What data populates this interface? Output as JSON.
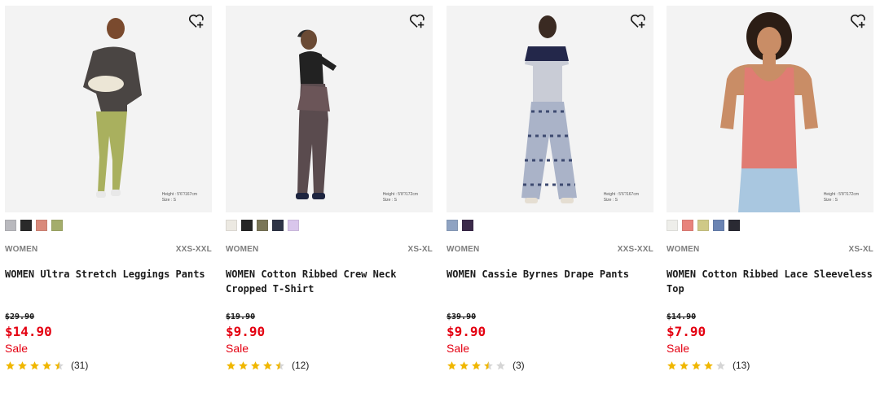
{
  "products": [
    {
      "gender": "WOMEN",
      "sizes": "XXS-XXL",
      "name": "WOMEN Ultra Stretch Leggings Pants",
      "original_price": "$29.90",
      "price": "$14.90",
      "sale_label": "Sale",
      "rating": 4.5,
      "review_count": "(31)",
      "model_height": "Height : 5'6\"/167cm",
      "model_size": "Size : S",
      "swatches": [
        "#b9b9be",
        "#2a2a2a",
        "#d98a7b",
        "#a4ad6b"
      ]
    },
    {
      "gender": "WOMEN",
      "sizes": "XS-XL",
      "name": "WOMEN Cotton Ribbed Crew Neck Cropped T-Shirt",
      "original_price": "$19.90",
      "price": "$9.90",
      "sale_label": "Sale",
      "rating": 4.5,
      "review_count": "(12)",
      "model_height": "Height : 5'8\"/172cm",
      "model_size": "Size : S",
      "swatches": [
        "#ece9e2",
        "#262626",
        "#7a7658",
        "#2f3547",
        "#d9c6ec"
      ]
    },
    {
      "gender": "WOMEN",
      "sizes": "XXS-XXL",
      "name": "WOMEN Cassie Byrnes Drape Pants",
      "original_price": "$39.90",
      "price": "$9.90",
      "sale_label": "Sale",
      "rating": 3.5,
      "review_count": "(3)",
      "model_height": "Height : 5'6\"/167cm",
      "model_size": "Size : S",
      "swatches": [
        "#8fa3c2",
        "#3b2a4a"
      ]
    },
    {
      "gender": "WOMEN",
      "sizes": "XS-XL",
      "name": "WOMEN Cotton Ribbed Lace Sleeveless Top",
      "original_price": "$14.90",
      "price": "$7.90",
      "sale_label": "Sale",
      "rating": 4,
      "review_count": "(13)",
      "model_height": "Height : 5'8\"/172cm",
      "model_size": "Size : S",
      "swatches": [
        "#eeeeea",
        "#e8837c",
        "#cfc987",
        "#6b84b3",
        "#2a2a33"
      ]
    }
  ],
  "icons": {
    "wishlist": "heart-plus-icon",
    "star": "star-icon"
  },
  "colors": {
    "sale_red": "#e40011",
    "star_gold": "#f0b700",
    "star_empty": "#d5d5d5"
  }
}
